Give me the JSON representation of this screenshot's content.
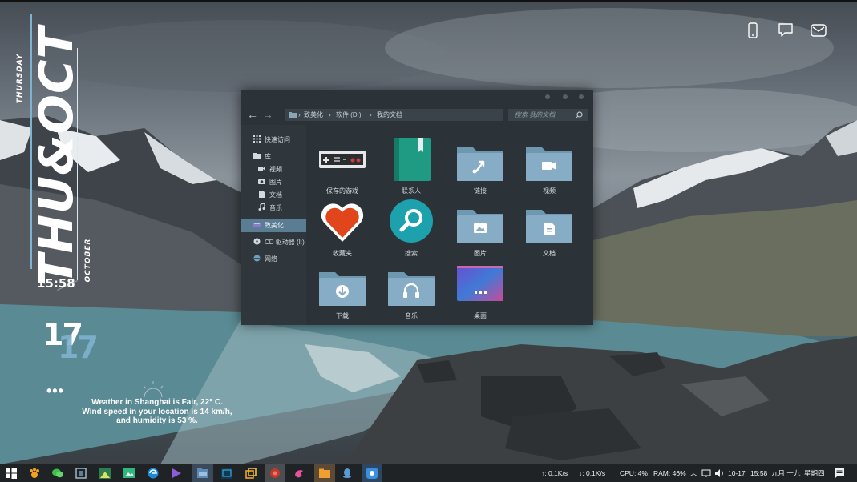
{
  "widget": {
    "day_month": "THU&OCT",
    "weekday_full": "THURSDAY",
    "month_full": "OCTOBER",
    "time": "15:58",
    "day": "17",
    "weather_lines": [
      "Weather in Shanghai is Fair, 22° C.",
      "Wind speed in your location is 14 km/h,",
      "and humidity is 53 %."
    ]
  },
  "top_right_icons": [
    "phone-icon",
    "chat-icon",
    "mail-icon"
  ],
  "explorer": {
    "breadcrumb": [
      "致美化",
      "软件 (D:)",
      "我的文档"
    ],
    "search_placeholder": "搜索 我的文档",
    "sidebar": [
      {
        "label": "快速访问",
        "icon": "grid-icon",
        "indent": 0
      },
      {
        "label": "库",
        "icon": "folder-icon",
        "indent": 0
      },
      {
        "label": "视频",
        "icon": "video-icon",
        "indent": 1
      },
      {
        "label": "图片",
        "icon": "camera-icon",
        "indent": 1
      },
      {
        "label": "文档",
        "icon": "document-icon",
        "indent": 1
      },
      {
        "label": "音乐",
        "icon": "music-icon",
        "indent": 1
      },
      {
        "label": "致美化",
        "icon": "drive-icon",
        "indent": 0,
        "selected": true
      },
      {
        "label": "CD 驱动器 (I:)",
        "icon": "cd-icon",
        "indent": 0
      },
      {
        "label": "网络",
        "icon": "network-icon",
        "indent": 0
      }
    ],
    "items": [
      {
        "label": "保存的游戏",
        "icon": "gamepad-icon"
      },
      {
        "label": "联系人",
        "icon": "contacts-book-icon"
      },
      {
        "label": "链接",
        "icon": "link-folder-icon"
      },
      {
        "label": "视频",
        "icon": "video-folder-icon"
      },
      {
        "label": "收藏夹",
        "icon": "heart-icon"
      },
      {
        "label": "搜索",
        "icon": "search-icon"
      },
      {
        "label": "图片",
        "icon": "pictures-folder-icon"
      },
      {
        "label": "文档",
        "icon": "documents-folder-icon"
      },
      {
        "label": "下载",
        "icon": "download-folder-icon"
      },
      {
        "label": "音乐",
        "icon": "music-folder-icon"
      },
      {
        "label": "桌面",
        "icon": "desktop-icon"
      }
    ]
  },
  "taskbar": {
    "upload": "↑: 0.1K/s",
    "download": "↓: 0.1K/s",
    "cpu": "CPU: 4%",
    "ram": "RAM: 46%",
    "date": "10-17",
    "time": "15:58",
    "lunar": "九月 十九",
    "weekday": "星期四"
  },
  "colors": {
    "accent": "#7fb2cf",
    "folder": "#7ea9c3",
    "window_bg": "#2c3338",
    "taskbar_bg": "#1f2326"
  }
}
